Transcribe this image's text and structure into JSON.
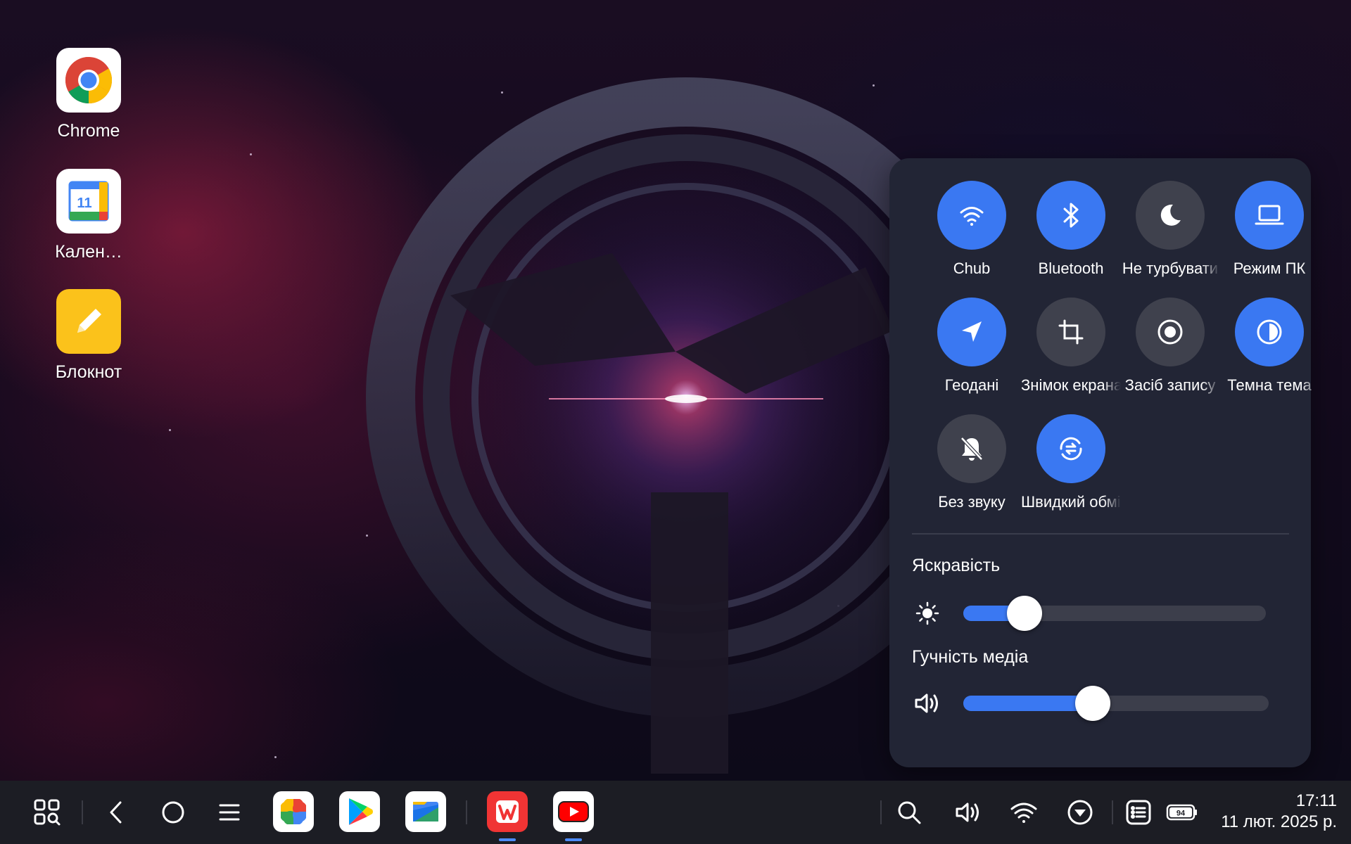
{
  "desktop": {
    "icons": [
      {
        "label": "Chrome"
      },
      {
        "label": "Кален…"
      },
      {
        "label": "Блокнот"
      }
    ]
  },
  "calendar_icon_day": "11",
  "quick_settings": {
    "tiles": [
      {
        "label": "Chub",
        "state": "on",
        "icon": "wifi-icon"
      },
      {
        "label": "Bluetooth",
        "state": "on",
        "icon": "bluetooth-icon"
      },
      {
        "label": "Не турбувати",
        "state": "off",
        "icon": "moon-icon"
      },
      {
        "label": "Режим ПК",
        "state": "on",
        "icon": "laptop-icon"
      },
      {
        "label": "Геодані",
        "state": "on",
        "icon": "location-arrow-icon"
      },
      {
        "label": "Знімок екрана",
        "state": "off",
        "icon": "crop-icon"
      },
      {
        "label": "Засіб запису",
        "state": "off",
        "icon": "record-icon"
      },
      {
        "label": "Темна тема",
        "state": "on",
        "icon": "contrast-icon"
      },
      {
        "label": "Без звуку",
        "state": "off",
        "icon": "bell-off-icon"
      },
      {
        "label": "Швидкий обмін",
        "state": "on",
        "icon": "quick-share-icon"
      }
    ],
    "brightness": {
      "label": "Яскравість",
      "value": 0.18
    },
    "media_volume": {
      "label": "Гучність медіа",
      "value": 0.4
    }
  },
  "taskbar": {
    "battery": "94",
    "time": "17:11",
    "date": "11 лют. 2025 р.",
    "colors": {
      "accent": "#3a78f2",
      "panel": "#222535",
      "taskbar": "#1c1d24"
    }
  }
}
